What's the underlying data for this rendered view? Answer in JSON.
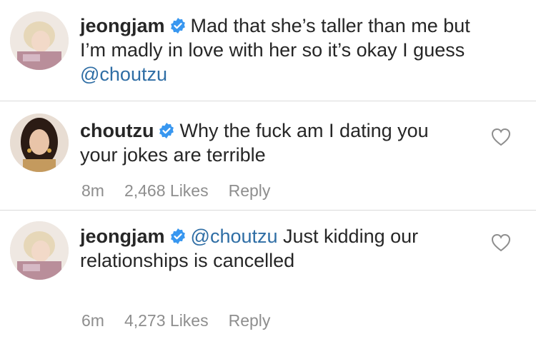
{
  "comments": [
    {
      "username": "jeongjam",
      "verified": true,
      "text_before": "Mad that she’s taller than me but I’m madly in love with her so it’s okay I guess ",
      "mention": "@choutzu",
      "text_after": "",
      "time": "",
      "likes": "",
      "reply": ""
    },
    {
      "username": "choutzu",
      "verified": true,
      "text_before": "Why the fuck am I dating you your jokes are terrible",
      "mention": "",
      "text_after": "",
      "time": "8m",
      "likes": "2,468 Likes",
      "reply": "Reply"
    },
    {
      "username": "jeongjam",
      "verified": true,
      "text_before": "",
      "mention": "@choutzu",
      "text_after": " Just kidding our relationships is cancelled",
      "time": "6m",
      "likes": "4,273 Likes",
      "reply": "Reply"
    }
  ],
  "colors": {
    "verified_badge": "#3897f0",
    "mention": "#2f6ea5",
    "meta_text": "#8e8e8e",
    "divider": "#dbdbdb"
  },
  "icons": [
    "verified-badge-icon",
    "heart-outline-icon"
  ]
}
